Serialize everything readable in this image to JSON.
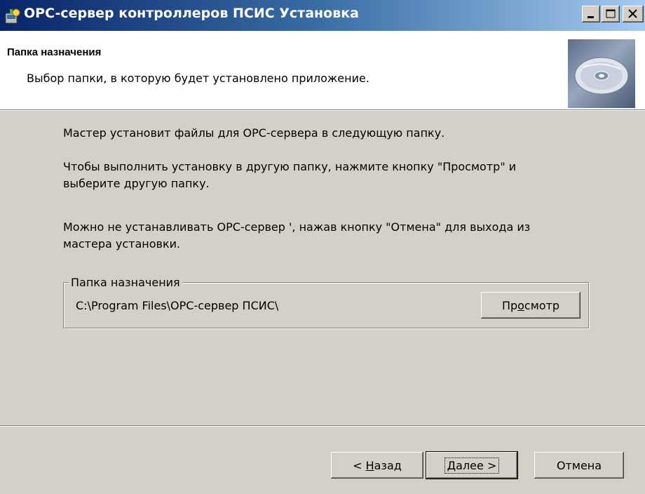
{
  "window": {
    "title": "OPC-сервер контроллеров ПСИС Установка",
    "minimize_icon": "minimize-icon",
    "maximize_icon": "maximize-icon",
    "close_icon": "close-icon",
    "app_icon": "installer-icon"
  },
  "header": {
    "title": "Папка назначения",
    "subtitle": "Выбор папки, в которую будет установлено приложение.",
    "image_icon": "cd-disc-icon"
  },
  "body": {
    "line1": "Мастер установит файлы для OPC-сервера  в следующую папку.",
    "line2a": "Чтобы выполнить установку в другую папку, нажмите кнопку \"Просмотр\" и",
    "line2b": "выберите другую папку.",
    "line3a": "Можно не устанавливать OPC-сервер ', нажав кнопку \"Отмена\" для выхода из",
    "line3b": "мастера установки."
  },
  "destination": {
    "group_label": "Папка назначения",
    "path": "C:\\Program Files\\OPC-сервер ПСИС\\",
    "browse_pre": "Пр",
    "browse_mnemonic": "о",
    "browse_post": "смотр"
  },
  "footer": {
    "back_pre": "< ",
    "back_mnemonic": "Н",
    "back_post": "азад",
    "next_mnemonic": "Д",
    "next_post": "алее >",
    "cancel": "Отмена"
  }
}
